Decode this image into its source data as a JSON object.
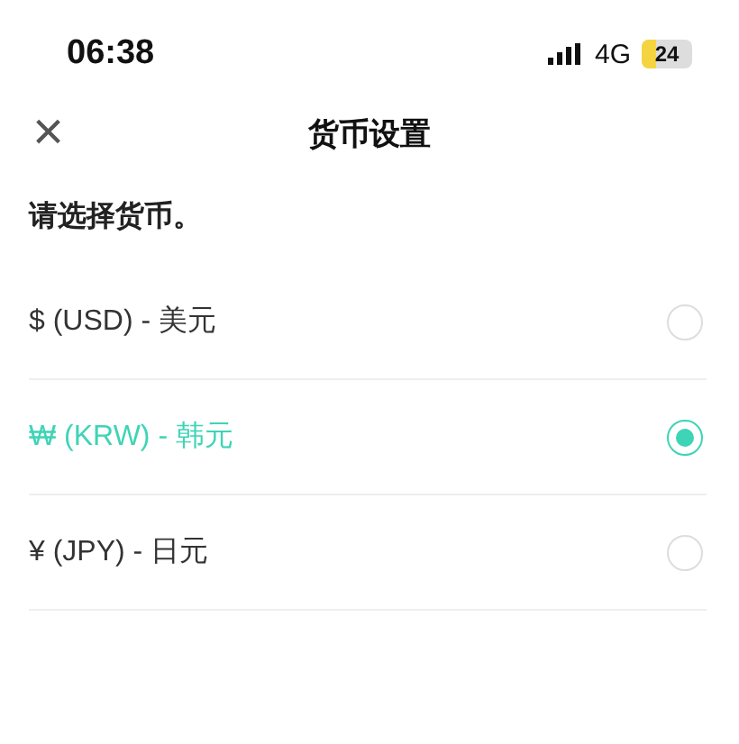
{
  "status_bar": {
    "time": "06:38",
    "network": "4G",
    "battery": "24"
  },
  "nav": {
    "close": "×",
    "title": "货币设置"
  },
  "prompt": "请选择货币。",
  "currencies": [
    {
      "label": "$ (USD) - 美元",
      "selected": false
    },
    {
      "label": "₩ (KRW) - 韩元",
      "selected": true
    },
    {
      "label": "¥ (JPY) - 日元",
      "selected": false
    }
  ]
}
